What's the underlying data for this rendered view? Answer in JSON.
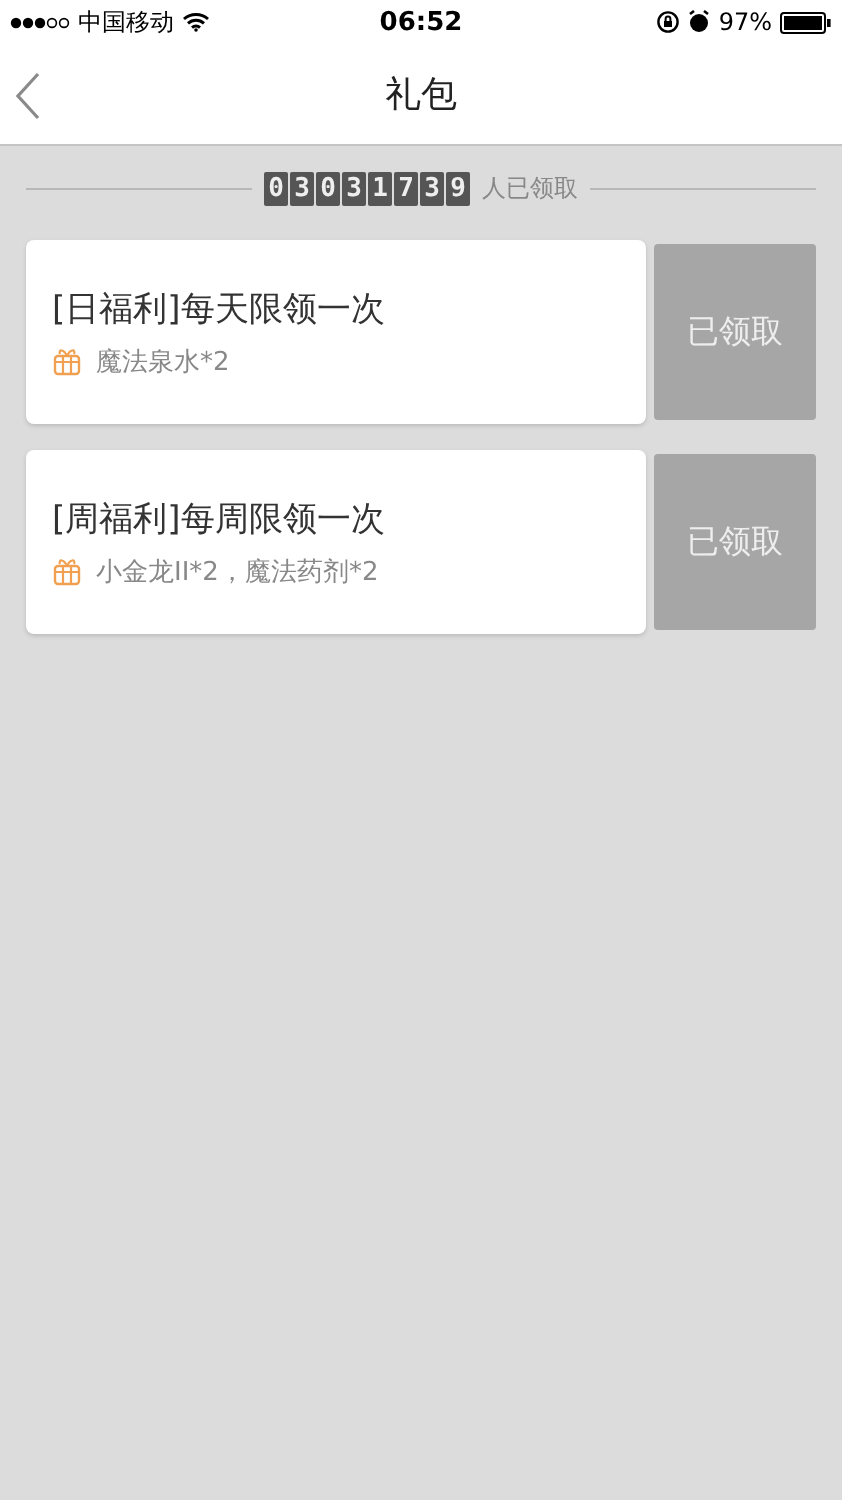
{
  "status_bar": {
    "carrier": "中国移动",
    "time": "06:52",
    "battery": "97%"
  },
  "nav": {
    "title": "礼包"
  },
  "counter": {
    "digits": [
      "0",
      "3",
      "0",
      "3",
      "1",
      "7",
      "3",
      "9"
    ],
    "suffix": "人已领取"
  },
  "gifts": [
    {
      "title": "[日福利]每天限领一次",
      "items": "魔法泉水*2",
      "claimed": true,
      "action": "已领取"
    },
    {
      "title": "[周福利]每周限领一次",
      "items": "小金龙II*2，魔法药剂*2",
      "claimed": true,
      "action": "已领取"
    }
  ]
}
